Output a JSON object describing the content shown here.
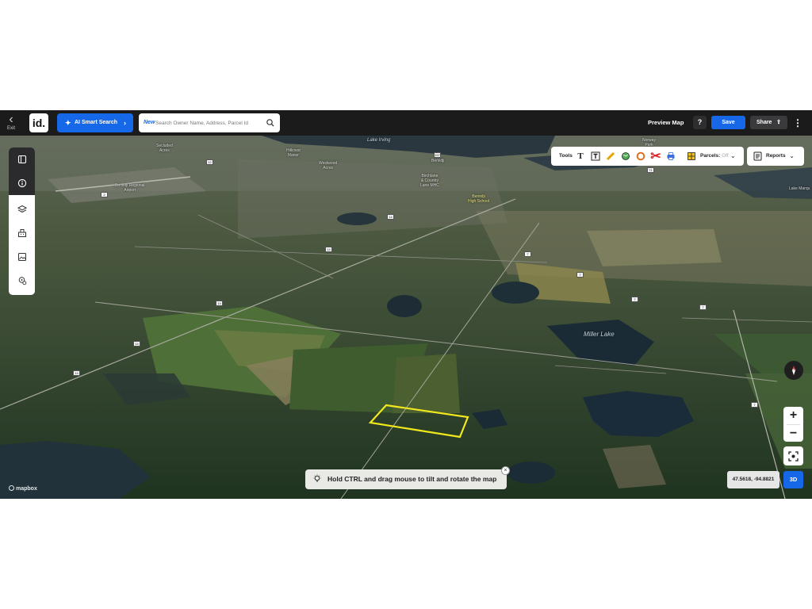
{
  "header": {
    "exit_label": "Exit",
    "logo_text": "id.",
    "ai_search_label": "AI Smart Search",
    "search_new_badge": "New",
    "search_placeholder": "Search Owner Name, Address, Parcel Id",
    "preview_map_label": "Preview Map",
    "help_label": "?",
    "save_label": "Save",
    "share_label": "Share"
  },
  "left_toolbar": {
    "items": [
      "panel-toggle-icon",
      "info-icon",
      "layers-icon",
      "buildings-icon",
      "image-icon",
      "location-icon"
    ]
  },
  "tools_bar": {
    "tools_label": "Tools",
    "parcels_label": "Parcels:",
    "parcels_state": "Off",
    "reports_label": "Reports"
  },
  "map": {
    "hint_text": "Hold CTRL and drag mouse to tilt and rotate the map",
    "coordinates": "47.5618, -94.8821",
    "mode_3d_label": "3D",
    "attribution": "mapbox",
    "zoom_in": "+",
    "zoom_out": "−",
    "labels": {
      "secluded_acres": "Secluded\nAcres",
      "hillcrest_manor": "Hillcrest\nManor",
      "westwood_acres": "Westwood\nAcres",
      "bemidji": "Bemidji",
      "birchlane": "Birchlane\n& Country\nLane MHC",
      "high_school": "Bemidji\nHigh School",
      "norway_park": "Norway\nPark",
      "regional_airport": "Bemidji Regional\nAirport",
      "lake_marquette": "Lake Marqu",
      "miller_lake": "Miller Lake",
      "lake_irving": "Lake Irving"
    },
    "route_shields": [
      "14",
      "14",
      "14",
      "14",
      "7",
      "7",
      "7",
      "7",
      "7",
      "197",
      "71",
      "2",
      "12",
      "15"
    ]
  },
  "colors": {
    "accent": "#1668e8",
    "topbar": "#1b1b1c",
    "parcel_outline": "#f1e81d"
  }
}
